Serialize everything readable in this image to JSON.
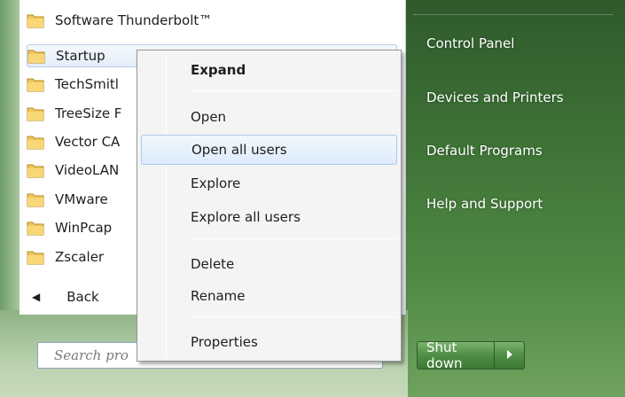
{
  "programs": [
    {
      "label": "Software Thunderbolt™",
      "selected": false
    },
    {
      "label": "Startup",
      "selected": true
    },
    {
      "label": "TechSmitl",
      "selected": false
    },
    {
      "label": "TreeSize F",
      "selected": false
    },
    {
      "label": "Vector CA",
      "selected": false
    },
    {
      "label": "VideoLAN",
      "selected": false
    },
    {
      "label": "VMware",
      "selected": false
    },
    {
      "label": "WinPcap",
      "selected": false
    },
    {
      "label": "Zscaler",
      "selected": false
    }
  ],
  "back": {
    "label": "Back",
    "icon": "triangle-left-icon"
  },
  "search": {
    "placeholder": "Search pro"
  },
  "right_links": [
    "Control Panel",
    "Devices and Printers",
    "Default Programs",
    "Help and Support"
  ],
  "shutdown": {
    "label": "Shut down",
    "arrow_icon": "triangle-right-icon"
  },
  "context_menu": {
    "items": [
      {
        "label": "Expand",
        "bold": true
      },
      {
        "label": "Open"
      },
      {
        "label": "Open all users",
        "highlighted": true
      },
      {
        "label": "Explore"
      },
      {
        "label": "Explore all users"
      },
      {
        "label": "Delete"
      },
      {
        "label": "Rename"
      },
      {
        "label": "Properties"
      }
    ]
  },
  "colors": {
    "folder": "#e8b84a",
    "highlight_border": "#a9caed",
    "frame_green": "#3e7236"
  }
}
